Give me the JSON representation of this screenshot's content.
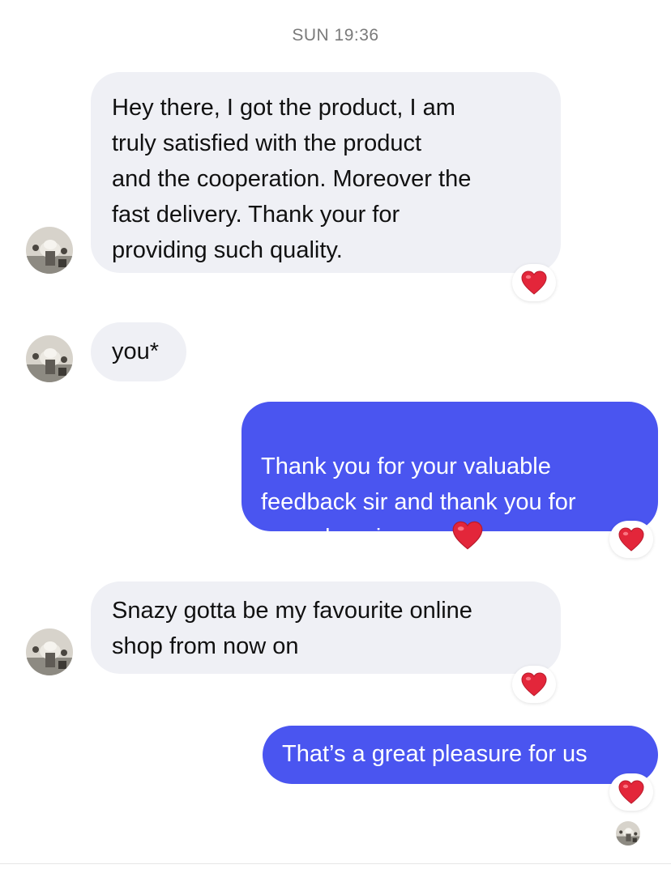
{
  "chat": {
    "timestamp": "SUN 19:36",
    "messages": [
      {
        "direction": "incoming",
        "text": "Hey there, I got the product, I am\ntruly satisfied with the product\nand the cooperation. Moreover the\nfast delivery. Thank your for\nproviding such quality.",
        "reaction": "red-heart"
      },
      {
        "direction": "incoming",
        "text": "you*"
      },
      {
        "direction": "outgoing",
        "text": "Thank you for your valuable\nfeedback sir and thank you for\nyour choosing uss",
        "trailing_emoji": "red-heart",
        "reaction": "red-heart"
      },
      {
        "direction": "incoming",
        "text": "Snazy gotta be my favourite online\nshop from now on",
        "reaction": "red-heart"
      },
      {
        "direction": "outgoing",
        "text": "That’s a great pleasure for us",
        "reaction": "red-heart"
      }
    ],
    "seen_indicator": "avatar"
  },
  "colors": {
    "incoming_bubble": "#eff0f5",
    "outgoing_bubble": "#4a55f0",
    "heart": "#e3263a",
    "timestamp_text": "#7a7a7a"
  }
}
